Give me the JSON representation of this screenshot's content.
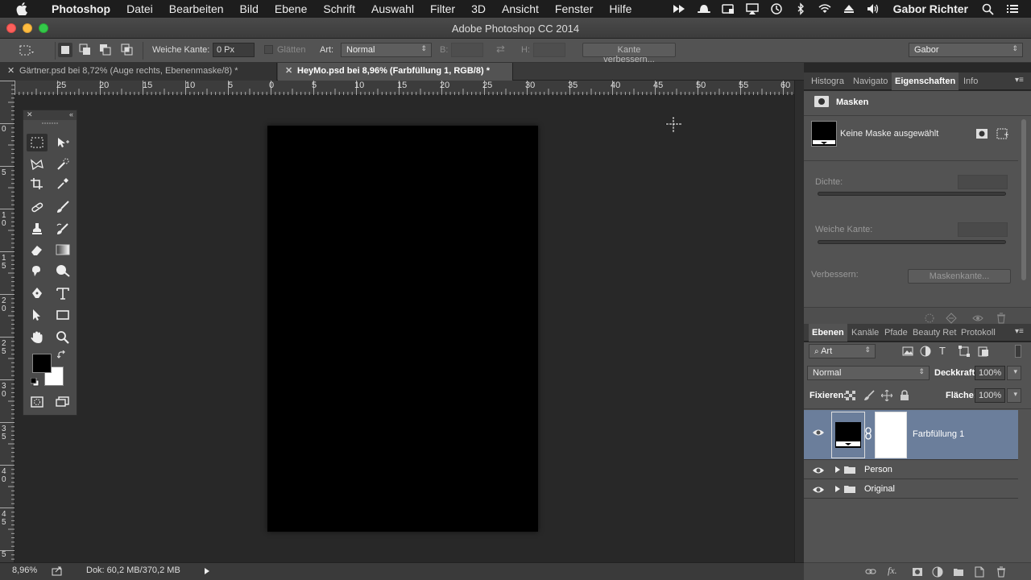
{
  "menubar": {
    "app": "Photoshop",
    "items": [
      "Datei",
      "Bearbeiten",
      "Bild",
      "Ebene",
      "Schrift",
      "Auswahl",
      "Filter",
      "3D",
      "Ansicht",
      "Fenster",
      "Hilfe"
    ],
    "user": "Gabor Richter"
  },
  "window": {
    "title": "Adobe Photoshop CC 2014"
  },
  "options": {
    "feather_label": "Weiche Kante:",
    "feather_value": "0 Px",
    "antialias_label": "Glätten",
    "style_label": "Art:",
    "style_value": "Normal",
    "width_label": "B:",
    "height_label": "H:",
    "refine_button": "Kante verbessern...",
    "workspace": "Gabor"
  },
  "tabs": [
    {
      "label": "Gärtner.psd bei 8,72% (Auge rechts, Ebenenmaske/8) *",
      "active": false
    },
    {
      "label": "HeyMo.psd bei 8,96% (Farbfüllung 1, RGB/8) *",
      "active": true
    }
  ],
  "ruler": {
    "top_labels": [
      "25",
      "20",
      "15",
      "10",
      "5",
      "0",
      "5",
      "10",
      "15",
      "20",
      "25",
      "30",
      "35",
      "40",
      "45",
      "50",
      "55",
      "60"
    ],
    "left_labels": [
      "0",
      "5",
      "10",
      "15",
      "20",
      "25",
      "30",
      "35",
      "40",
      "45",
      "5"
    ]
  },
  "status": {
    "zoom": "8,96%",
    "doc": "Dok: 60,2 MB/370,2 MB"
  },
  "properties_panel": {
    "tabs": [
      "Histogra",
      "Navigato",
      "Eigenschaften",
      "Info"
    ],
    "active_tab": "Eigenschaften",
    "section": "Masken",
    "mask_text": "Keine Maske ausgewählt",
    "density_label": "Dichte:",
    "feather_label": "Weiche Kante:",
    "refine_label": "Verbessern:",
    "mask_edge_button": "Maskenkante..."
  },
  "layers_panel": {
    "tabs": [
      "Ebenen",
      "Kanäle",
      "Pfade",
      "Beauty Ret",
      "Protokoll"
    ],
    "active_tab": "Ebenen",
    "filter": "Art",
    "blend_mode": "Normal",
    "opacity_label": "Deckkraft:",
    "opacity": "100%",
    "lock_label": "Fixieren:",
    "fill_label": "Fläche:",
    "fill": "100%",
    "layers": [
      {
        "name": "Farbfüllung 1",
        "type": "fill",
        "selected": true
      },
      {
        "name": "Person",
        "type": "group",
        "selected": false
      },
      {
        "name": "Original",
        "type": "group",
        "selected": false
      }
    ]
  },
  "colors": {
    "foreground": "#000000",
    "background": "#ffffff",
    "selected_layer": "#6b7e9b",
    "panel": "#535353"
  }
}
